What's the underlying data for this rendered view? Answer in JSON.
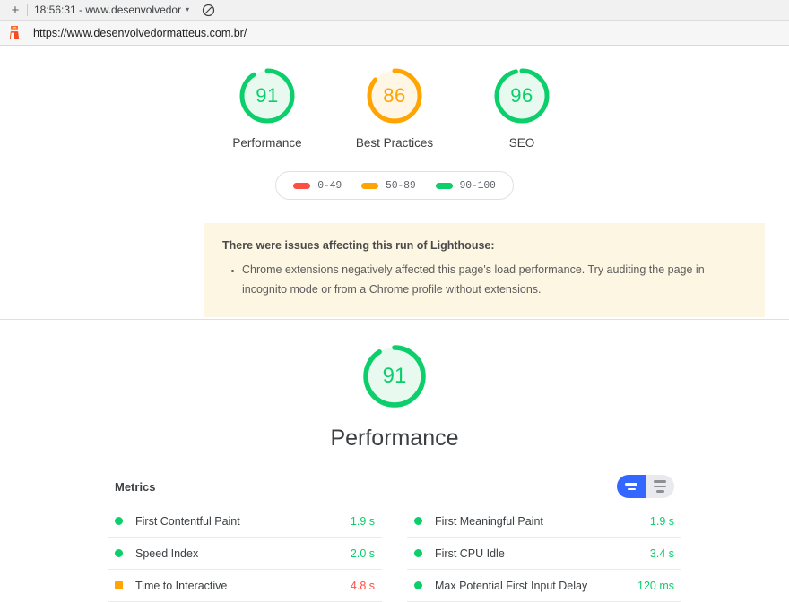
{
  "browser": {
    "new_tab_label": "+",
    "tab_title": "18:56:31 - www.desenvolvedor",
    "tab_caret": "▾",
    "block_icon_name": "block-icon",
    "url": "https://www.desenvolvedormatteus.com.br/"
  },
  "colors": {
    "pass": "#0cce6b",
    "average": "#ffa400",
    "fail": "#ff4e42",
    "accent_blue": "#3367ff",
    "warning_bg": "#fdf6e3"
  },
  "scores": [
    {
      "value": "91",
      "label": "Performance",
      "rating": "pass",
      "percent": 91
    },
    {
      "value": "86",
      "label": "Best Practices",
      "rating": "average",
      "percent": 86
    },
    {
      "value": "96",
      "label": "SEO",
      "rating": "pass",
      "percent": 96
    }
  ],
  "legend": [
    {
      "range": "0-49",
      "rating": "fail"
    },
    {
      "range": "50-89",
      "rating": "average"
    },
    {
      "range": "90-100",
      "rating": "pass"
    }
  ],
  "warning": {
    "title": "There were issues affecting this run of Lighthouse:",
    "items": [
      "Chrome extensions negatively affected this page's load performance. Try auditing the page in incognito mode or from a Chrome profile without extensions."
    ]
  },
  "performance_section": {
    "score": "91",
    "percent": 91,
    "rating": "pass",
    "title": "Performance"
  },
  "metrics": {
    "heading": "Metrics",
    "toggle": {
      "simple_label": "simple-view-toggle",
      "detail_label": "detail-view-toggle",
      "active": "simple"
    },
    "left_column": [
      {
        "name": "First Contentful Paint",
        "value": "1.9 s",
        "rating": "pass"
      },
      {
        "name": "Speed Index",
        "value": "2.0 s",
        "rating": "pass"
      },
      {
        "name": "Time to Interactive",
        "value": "4.8 s",
        "rating": "average"
      }
    ],
    "right_column": [
      {
        "name": "First Meaningful Paint",
        "value": "1.9 s",
        "rating": "pass"
      },
      {
        "name": "First CPU Idle",
        "value": "3.4 s",
        "rating": "pass"
      },
      {
        "name": "Max Potential First Input Delay",
        "value": "120 ms",
        "rating": "pass"
      }
    ]
  }
}
